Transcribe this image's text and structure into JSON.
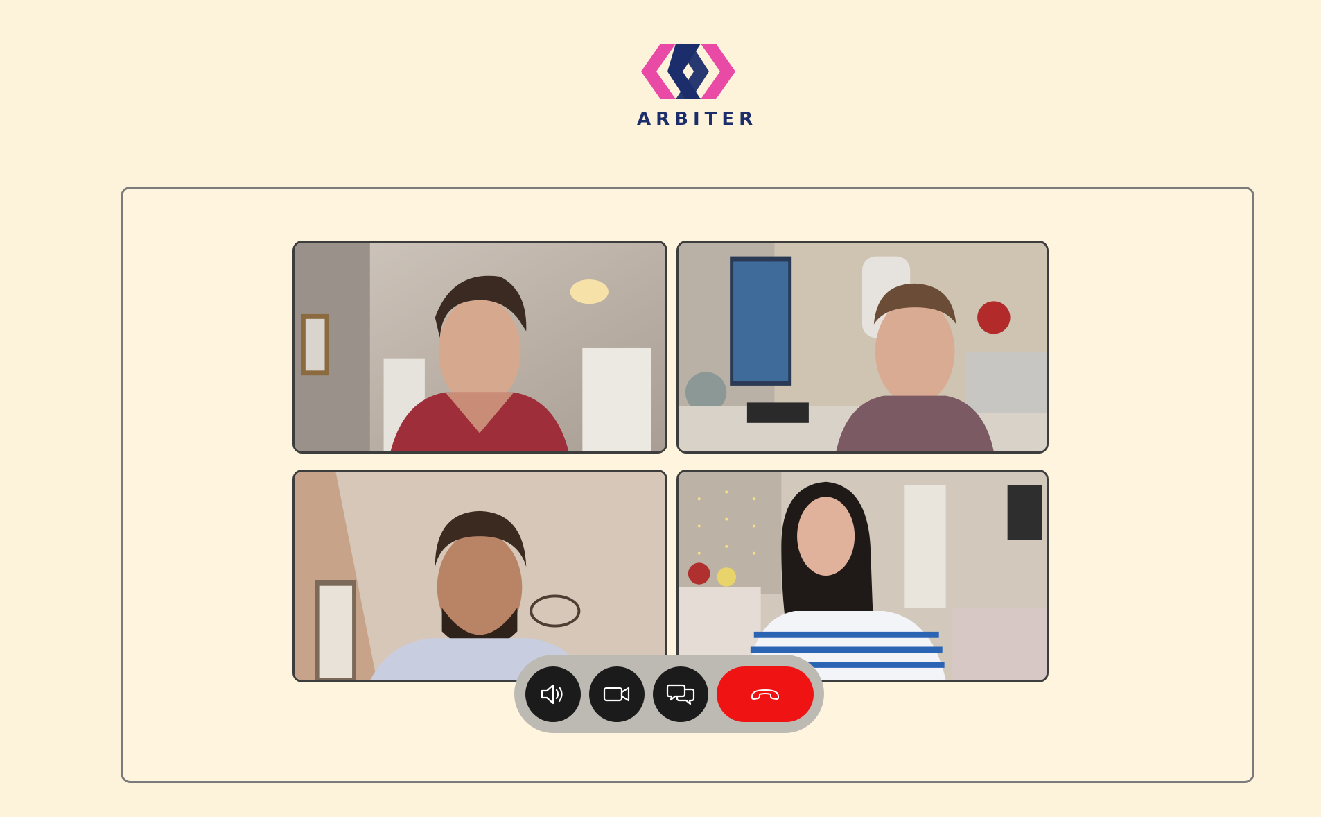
{
  "app": {
    "brand_name": "ARBITER",
    "brand_colors": {
      "pink": "#e84aa6",
      "navy": "#1c2d6b"
    },
    "background": "#fdf2da"
  },
  "call": {
    "participants": [
      {
        "tile": "participant-1-video"
      },
      {
        "tile": "participant-2-video"
      },
      {
        "tile": "participant-3-video"
      },
      {
        "tile": "participant-4-video"
      }
    ]
  },
  "controls": {
    "buttons": [
      {
        "name": "speaker-button",
        "icon": "speaker-icon"
      },
      {
        "name": "camera-button",
        "icon": "video-camera-icon"
      },
      {
        "name": "chat-button",
        "icon": "chat-bubbles-icon"
      },
      {
        "name": "end-call-button",
        "icon": "phone-hangup-icon",
        "color": "#f01313"
      }
    ]
  }
}
